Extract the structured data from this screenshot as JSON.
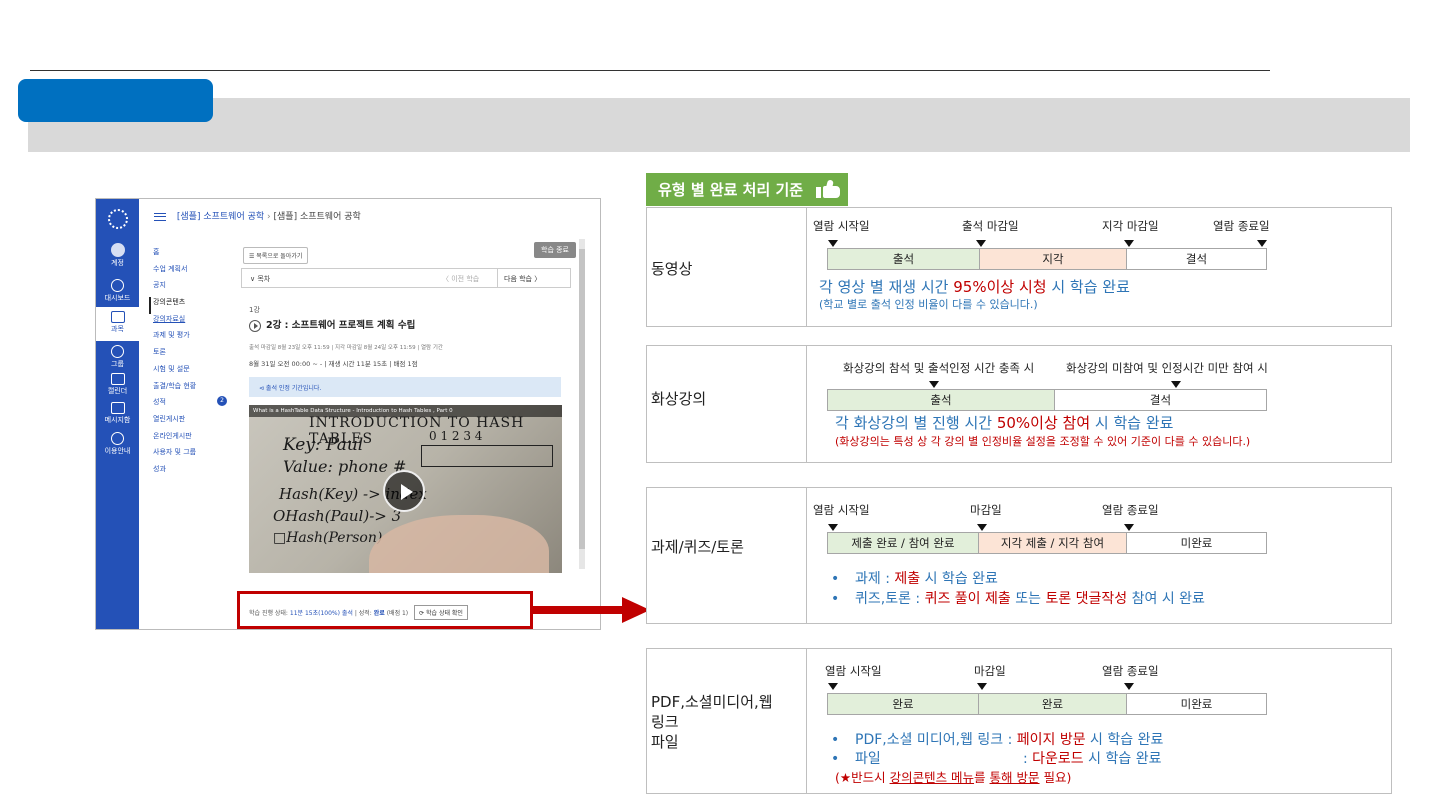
{
  "lms": {
    "nav": [
      {
        "label": "계정",
        "icon": "user-icon"
      },
      {
        "label": "대시보드",
        "icon": "dashboard-icon"
      },
      {
        "label": "과목",
        "icon": "book-icon"
      },
      {
        "label": "그룹",
        "icon": "group-icon"
      },
      {
        "label": "캘린더",
        "icon": "calendar-icon"
      },
      {
        "label": "메시지함",
        "icon": "inbox-icon"
      },
      {
        "label": "이용안내",
        "icon": "help-icon"
      }
    ],
    "breadcrumb": {
      "part1": "[샘플] 소프트웨어 공학",
      "sep": "›",
      "part2": "[샘플] 소프트웨어 공학"
    },
    "menu": [
      "홈",
      "수업 계획서",
      "공지",
      "강의콘텐츠",
      "강의자료실",
      "과제 및 평가",
      "토론",
      "시험 및 설문",
      "출결/학습 현황",
      "성적",
      "열린게시판",
      "온라인게시판",
      "사용자 및 그룹",
      "성과"
    ],
    "grade_badge": "2",
    "back_button": "☰ 목록으로 돌아가기",
    "finish_button": "학습 종료",
    "nav_toc": "∨ 목차",
    "nav_prev": "〈 이전 학습",
    "nav_next": "다음 학습 〉",
    "lecture_no": "1강",
    "lecture_title": "2강 : 소프트웨어 프로젝트 계획 수립",
    "meta1": "출석 마감일 8월 23일 오후 11:59 | 지각 마감일 8월 24일 오후 11:59 | 열람 기간",
    "meta2": "8월 31일 오전 00:00 ~ - | 재생 시간 11분 15초 | 배점 1점",
    "notice": "⊲ 출석 인정 기간입니다.",
    "video_title": "What is a HashTable Data Structure - Introduction to Hash Tables , Part 0",
    "video_lines": [
      "INTRODUCTION TO HASH TABLES",
      "Key: Paul",
      "Value: phone #",
      "0  1  2  3  4",
      "Hash(Key) -> index",
      "OHash(Paul)-> 3",
      "□Hash(Person)"
    ],
    "status_prefix": "학습 진행 상태:",
    "status_value": "11분 15초(100%) 출석",
    "status_mid": "| 성적:",
    "status_grade": "완료",
    "status_suffix": "(배점 1)",
    "check_button": "⟳ 학습 상태 확인"
  },
  "criteria_title": "유형 별 완료 처리 기준",
  "cards": {
    "video": {
      "label": "동영상",
      "markers": [
        "열람 시작일",
        "출석 마감일",
        "지각 마감일",
        "열람 종료일"
      ],
      "segments": [
        "출석",
        "지각",
        "결석"
      ],
      "main_a": "각 영상 별 재생 시간 ",
      "main_red": "95%이상 시청",
      "main_b": " 시 학습 완료",
      "sub": "(학교 별로 출석 인정 비율이 다를 수 있습니다.)"
    },
    "live": {
      "label": "화상강의",
      "markers": [
        "화상강의 참석 및 출석인정 시간 충족 시",
        "화상강의 미참여 및 인정시간 미만 참여 시"
      ],
      "segments": [
        "출석",
        "결석"
      ],
      "main_a": "각 화상강의 별 진행 시간 ",
      "main_red": "50%이상 참여",
      "main_b": " 시 학습 완료",
      "sub": "(화상강의는 특성 상 각 강의 별 인정비율 설정을 조정할 수 있어 기준이 다를 수 있습니다.)"
    },
    "assign": {
      "label": "과제/퀴즈/토론",
      "markers": [
        "열람 시작일",
        "마감일",
        "열람 종료일"
      ],
      "segments": [
        "제출 완료 / 참여 완료",
        "지각 제출 / 지각 참여",
        "미완료"
      ],
      "b1_a": "과제 : ",
      "b1_red": "제출",
      "b1_b": " 시 학습 완료",
      "b2_a": "퀴즈,토론 : ",
      "b2_red1": "퀴즈 풀이 제출",
      "b2_mid": " 또는 ",
      "b2_red2": "토론 댓글작성",
      "b2_b": " 참여 시 완료"
    },
    "pdf": {
      "label_l1": "PDF,소셜미디어,웹",
      "label_l2": "링크",
      "label_l3": "파일",
      "markers": [
        "열람 시작일",
        "마감일",
        "열람 종료일"
      ],
      "segments": [
        "완료",
        "완료",
        "미완료"
      ],
      "b1_a": "PDF,소셜 미디어,웹 링크 : ",
      "b1_red": "페이지 방문",
      "b1_b": " 시 학습 완료",
      "b2_a": "파일",
      "b2_colon": ": ",
      "b2_red": "다운로드",
      "b2_b": " 시 학습 완료",
      "note_a": "(★반드시 ",
      "note_u": "강의콘텐츠 메뉴",
      "note_b": "를 ",
      "note_u2": "통해 방문",
      "note_c": " 필요)"
    }
  },
  "colors": {
    "accent_blue": "#0070c0",
    "tag_green": "#70ad47",
    "highlight_red": "#c00000",
    "lms_blue": "#2451b7"
  }
}
